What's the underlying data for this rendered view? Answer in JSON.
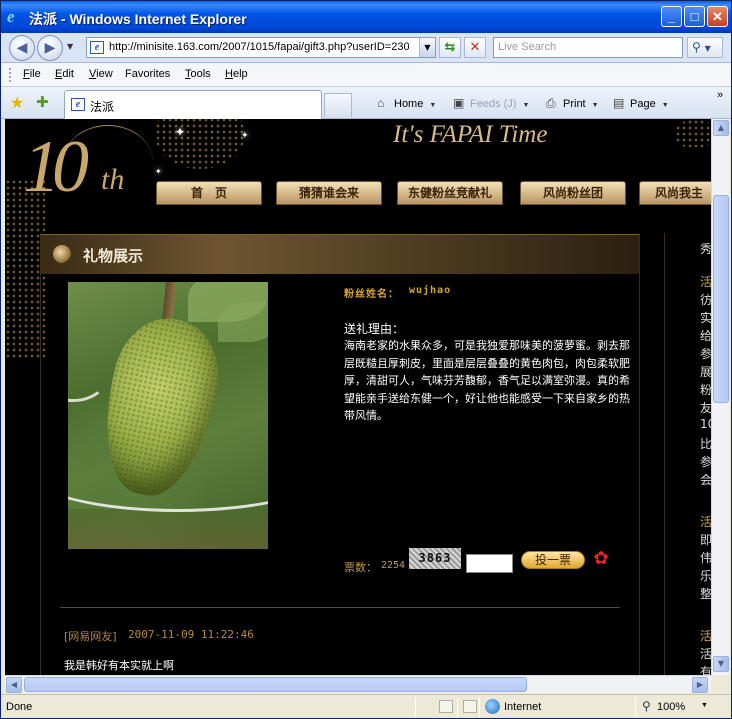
{
  "window": {
    "title": "法派 - Windows Internet Explorer",
    "min_label": "_",
    "max_label": "□",
    "close_label": "✕"
  },
  "toolbar": {
    "back_icon": "◀",
    "forward_icon": "▶",
    "address_url": "http://minisite.163.com/2007/1015/fapai/gift3.php?userID=230",
    "search_placeholder": "Live Search",
    "refresh_icon": "⇆",
    "stop_icon": "✕",
    "search_icon": "⚲"
  },
  "menu": {
    "items": [
      {
        "underline": "F",
        "rest": "ile"
      },
      {
        "underline": "E",
        "rest": "dit"
      },
      {
        "underline": "V",
        "rest": "iew"
      },
      {
        "underline": "F",
        "rest": "avorites",
        "split": "Fa"
      },
      {
        "underline": "T",
        "rest": "ools"
      },
      {
        "underline": "H",
        "rest": "elp"
      }
    ]
  },
  "tabs": {
    "active_label": "法派",
    "home_label": "Home",
    "feeds_label": "Feeds (J)",
    "print_label": "Print",
    "page_label": "Page",
    "more_label": "»"
  },
  "page": {
    "logo_number": "10",
    "logo_suffix": "th",
    "slogan": "It's FAPAI Time",
    "nav": [
      "首　页",
      "猜猜谁会来",
      "东健粉丝竞献礼",
      "风尚粉丝团",
      "风尚我主"
    ],
    "section_title": "礼物展示",
    "fan_label": "粉丝姓名：",
    "fan_name": "wujhao",
    "reason_label": "送礼理由：",
    "reason_text": "海南老家的水果众多，可是我独爱那味美的菠萝蜜。剥去那层既糙且厚刺皮，里面是层层叠叠的黄色肉包，肉包柔软肥厚，清甜可人，气味芬芳馥郁，香气足以满室弥漫。真的希望能亲手送给东健一个，好让他也能感受一下来自家乡的热带风情。",
    "votes_label": "票数：",
    "votes_count": "2254",
    "captcha_text": "3863",
    "vote_button": "投一票",
    "commenter": "[网易网友]",
    "comment_time": "2007-11-09 11:22:46",
    "comment_text": "我是韩好有本实就上啊",
    "right_column_chars": [
      {
        "t": "秀",
        "c": ""
      },
      {
        "t": "活",
        "c": "gold"
      },
      {
        "t": "彷",
        "c": ""
      },
      {
        "t": "实",
        "c": ""
      },
      {
        "t": "给",
        "c": ""
      },
      {
        "t": "参",
        "c": ""
      },
      {
        "t": "展",
        "c": ""
      },
      {
        "t": "粉",
        "c": ""
      },
      {
        "t": "友",
        "c": ""
      },
      {
        "t": "10",
        "c": ""
      },
      {
        "t": "比",
        "c": ""
      },
      {
        "t": "参",
        "c": ""
      },
      {
        "t": "会",
        "c": ""
      },
      {
        "t": "活",
        "c": "gold"
      },
      {
        "t": "即",
        "c": ""
      },
      {
        "t": "伟",
        "c": ""
      },
      {
        "t": "乐",
        "c": ""
      },
      {
        "t": "整",
        "c": ""
      },
      {
        "t": "活",
        "c": "gold"
      },
      {
        "t": "活",
        "c": ""
      },
      {
        "t": "有",
        "c": ""
      }
    ]
  },
  "status": {
    "done": "Done",
    "zone": "Internet",
    "zoom": "100%"
  }
}
